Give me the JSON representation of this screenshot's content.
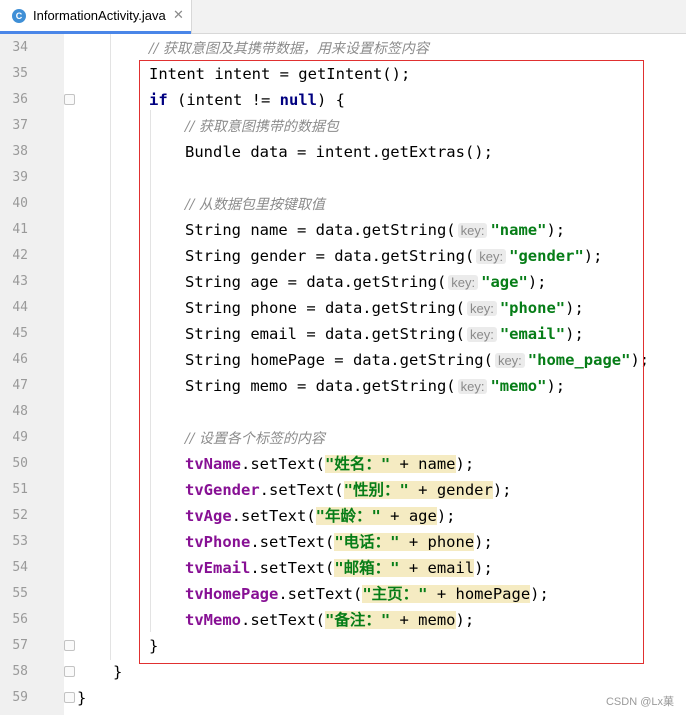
{
  "tab": {
    "icon": "java-class-icon",
    "icon_letter": "C",
    "title": "InformationActivity.java",
    "close": "✕"
  },
  "lines": [
    {
      "n": "34"
    },
    {
      "n": "35"
    },
    {
      "n": "36"
    },
    {
      "n": "37"
    },
    {
      "n": "38"
    },
    {
      "n": "39"
    },
    {
      "n": "40"
    },
    {
      "n": "41"
    },
    {
      "n": "42"
    },
    {
      "n": "43"
    },
    {
      "n": "44"
    },
    {
      "n": "45"
    },
    {
      "n": "46"
    },
    {
      "n": "47"
    },
    {
      "n": "48"
    },
    {
      "n": "49"
    },
    {
      "n": "50"
    },
    {
      "n": "51"
    },
    {
      "n": "52"
    },
    {
      "n": "53"
    },
    {
      "n": "54"
    },
    {
      "n": "55"
    },
    {
      "n": "56"
    },
    {
      "n": "57"
    },
    {
      "n": "58"
    },
    {
      "n": "59"
    }
  ],
  "code": {
    "l34": {
      "c": "// 获取意图及其携带数据，用来设置标签内容"
    },
    "l35": {
      "a": "Intent intent = getIntent();"
    },
    "l36": {
      "kw1": "if",
      "a": " (intent != ",
      "kw2": "null",
      "b": ") {"
    },
    "l37": {
      "c": "// 获取意图携带的数据包"
    },
    "l38": {
      "a": "Bundle data = intent.getExtras();"
    },
    "l40": {
      "c": "// 从数据包里按键取值"
    },
    "l41": {
      "a": "String name = data.getString(",
      "h": "key:",
      "s": "\"name\"",
      "b": ");"
    },
    "l42": {
      "a": "String gender = data.getString(",
      "h": "key:",
      "s": "\"gender\"",
      "b": ");"
    },
    "l43": {
      "a": "String age = data.getString(",
      "h": "key:",
      "s": "\"age\"",
      "b": ");"
    },
    "l44": {
      "a": "String phone = data.getString(",
      "h": "key:",
      "s": "\"phone\"",
      "b": ");"
    },
    "l45": {
      "a": "String email = data.getString(",
      "h": "key:",
      "s": "\"email\"",
      "b": ");"
    },
    "l46": {
      "a": "String homePage = data.getString(",
      "h": "key:",
      "s": "\"home_page\"",
      "b": ");"
    },
    "l47": {
      "a": "String memo = data.getString(",
      "h": "key:",
      "s": "\"memo\"",
      "b": ");"
    },
    "l49": {
      "c": "// 设置各个标签的内容"
    },
    "l50": {
      "f": "tvName",
      "a": ".setText(",
      "s": "\"姓名：\"",
      "b": " + name",
      "e": ");"
    },
    "l51": {
      "f": "tvGender",
      "a": ".setText(",
      "s": "\"性别：\"",
      "b": " + gender",
      "e": ");"
    },
    "l52": {
      "f": "tvAge",
      "a": ".setText(",
      "s": "\"年龄：\"",
      "b": " + age",
      "e": ");"
    },
    "l53": {
      "f": "tvPhone",
      "a": ".setText(",
      "s": "\"电话：\"",
      "b": " + phone",
      "e": ");"
    },
    "l54": {
      "f": "tvEmail",
      "a": ".setText(",
      "s": "\"邮箱：\"",
      "b": " + email",
      "e": ");"
    },
    "l55": {
      "f": "tvHomePage",
      "a": ".setText(",
      "s": "\"主页：\"",
      "b": " + homePage",
      "e": ");"
    },
    "l56": {
      "f": "tvMemo",
      "a": ".setText(",
      "s": "\"备注：\"",
      "b": " + memo",
      "e": ");"
    },
    "l57": {
      "a": "}"
    },
    "l58": {
      "a": "}"
    },
    "l59": {
      "a": "}"
    }
  },
  "watermark": "CSDN @Lx菓",
  "colors": {
    "keyword": "#000080",
    "string": "#067d17",
    "comment": "#8c8c8c",
    "field": "#871094",
    "highlight_box": "#e03030",
    "tab_accent": "#4a86e8"
  }
}
